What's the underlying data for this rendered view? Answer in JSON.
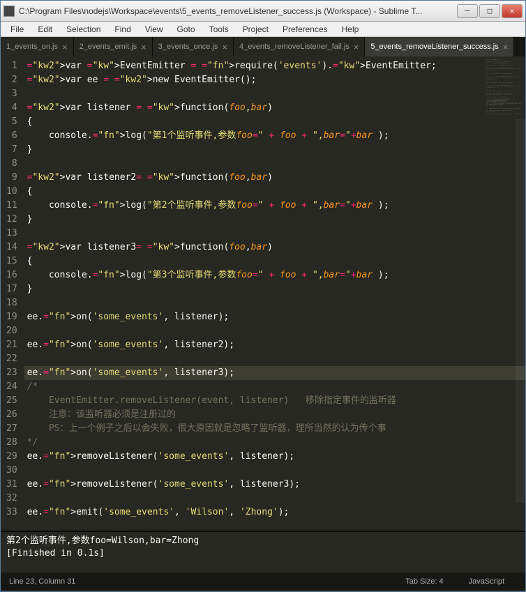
{
  "window": {
    "title": "C:\\Program Files\\nodejs\\Workspace\\events\\5_events_removeListener_success.js (Workspace) - Sublime T..."
  },
  "menu": {
    "items": [
      "File",
      "Edit",
      "Selection",
      "Find",
      "View",
      "Goto",
      "Tools",
      "Project",
      "Preferences",
      "Help"
    ]
  },
  "tabs": [
    {
      "label": "1_events_on.js",
      "active": false
    },
    {
      "label": "2_events_emit.js",
      "active": false
    },
    {
      "label": "3_events_once.js",
      "active": false
    },
    {
      "label": "4_events_removeListener_fail.js",
      "active": false
    },
    {
      "label": "5_events_removeListener_success.js",
      "active": true
    }
  ],
  "editor": {
    "line_count": 33,
    "current_line": 23,
    "lines": [
      "var EventEmitter = require('events').EventEmitter;",
      "var ee = new EventEmitter();",
      "",
      "var listener = function(foo,bar)",
      "{",
      "    console.log(\"第1个监听事件,参数foo=\" + foo + \",bar=\"+bar );",
      "}",
      "",
      "var listener2= function(foo,bar)",
      "{",
      "    console.log(\"第2个监听事件,参数foo=\" + foo + \",bar=\"+bar );",
      "}",
      "",
      "var listener3= function(foo,bar)",
      "{",
      "    console.log(\"第3个监听事件,参数foo=\" + foo + \",bar=\"+bar );",
      "}",
      "",
      "ee.on('some_events', listener);",
      "",
      "ee.on('some_events', listener2);",
      "",
      "ee.on('some_events', listener3);",
      "/*",
      "    EventEmitter.removeListener(event, listener)   移除指定事件的监听器",
      "    注意：该监听器必须是注册过的",
      "    PS：上一个例子之后以会失败，很大原因就是忽略了监听器，理所当然的认为传个事",
      "*/",
      "ee.removeListener('some_events', listener);",
      "",
      "ee.removeListener('some_events', listener3);",
      "",
      "ee.emit('some_events', 'Wilson', 'Zhong');"
    ]
  },
  "console": {
    "line1": "第2个监听事件,参数foo=Wilson,bar=Zhong",
    "line2": "[Finished in 0.1s]"
  },
  "status": {
    "cursor": "Line 23, Column 31",
    "tabsize": "Tab Size: 4",
    "syntax": "JavaScript"
  }
}
